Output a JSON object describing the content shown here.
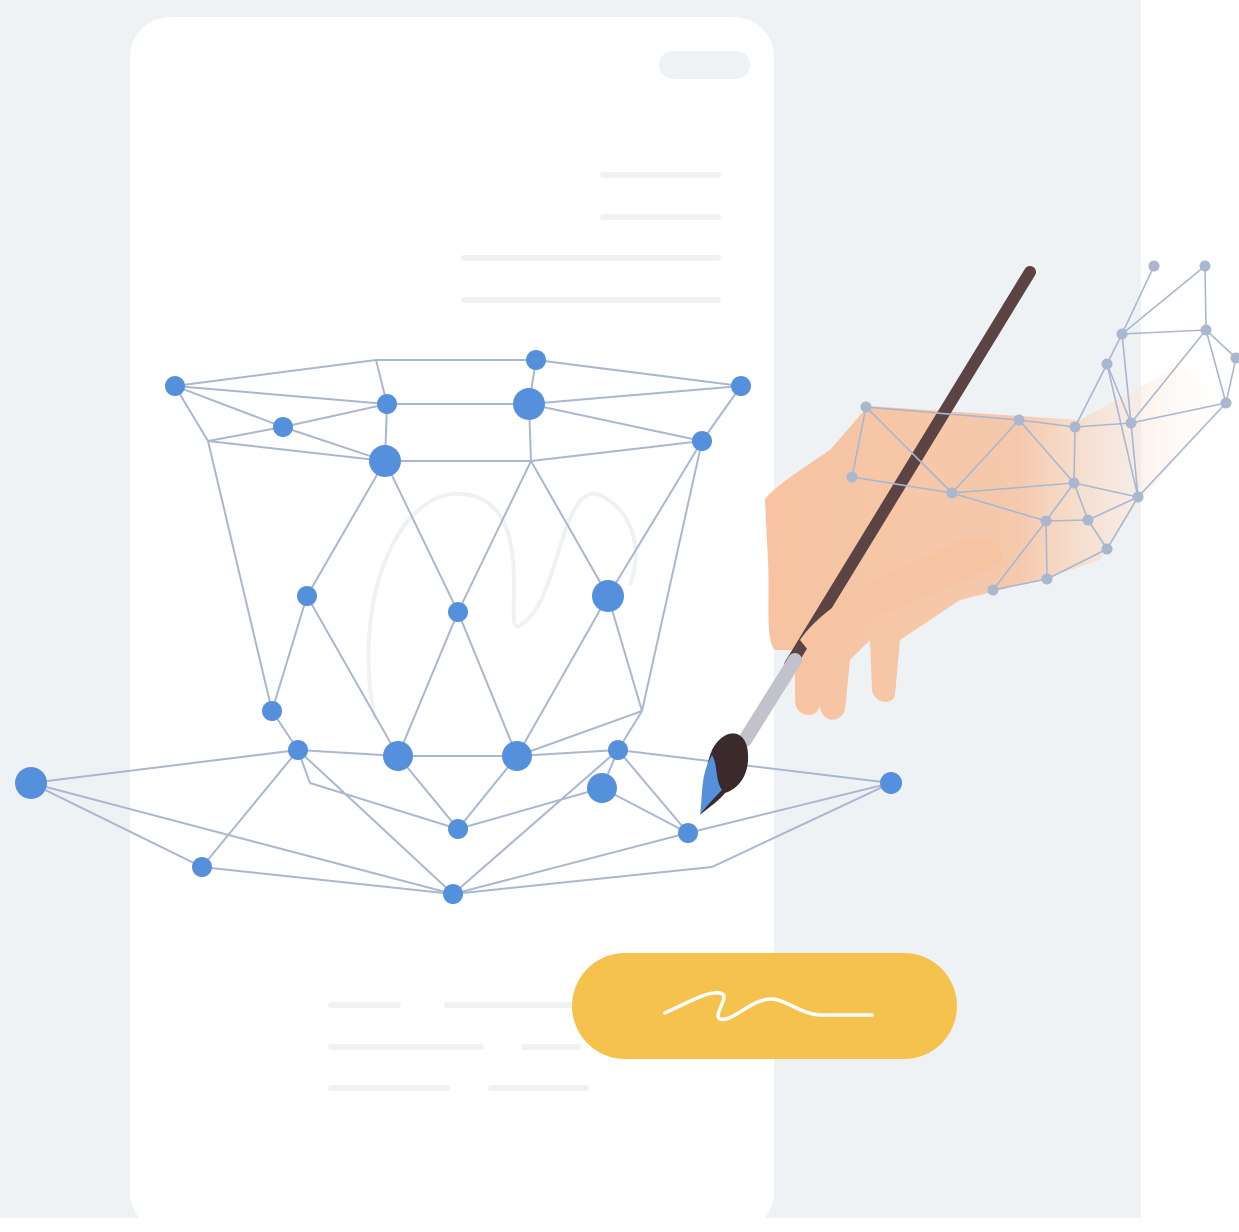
{
  "colors": {
    "background": "#eff2f5",
    "card": "#ffffff",
    "placeholder_line": "#eef2f5",
    "mesh_line": "#a9b7d0",
    "mesh_node": "#5590dc",
    "hand_mesh_node": "#aab7cf",
    "skin": "#f7c6a5",
    "brush_handle": "#5c4444",
    "brush_ferrule": "#c2c2cc",
    "brush_bristles": "#3a2a2c",
    "paint": "#5590dc",
    "signature_button": "#f5c24e",
    "signature_stroke": "#ffffff"
  },
  "icons": {
    "face_mesh": "face-mesh-icon",
    "hand": "hand-with-brush-icon",
    "signature": "signature-scribble-icon"
  }
}
